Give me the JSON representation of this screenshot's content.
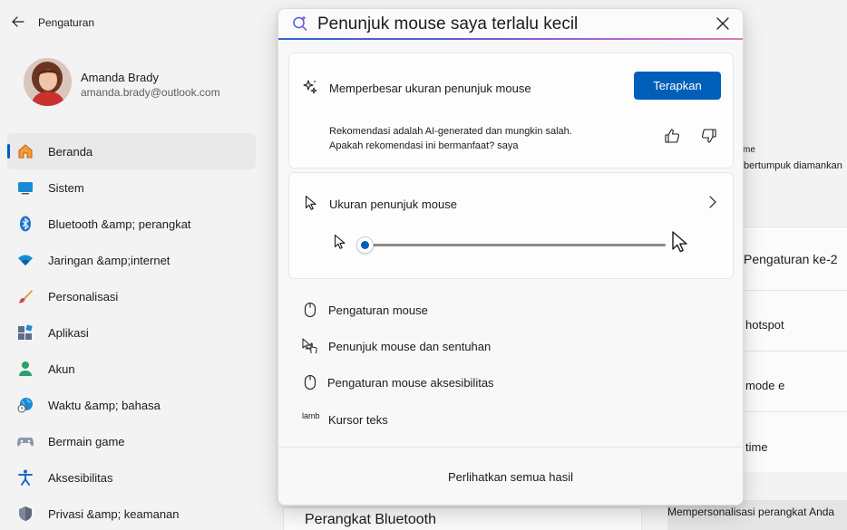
{
  "app": {
    "title": "Pengaturan"
  },
  "profile": {
    "name": "Amanda Brady",
    "email": "amanda.brady@outlook.com"
  },
  "nav": [
    {
      "label": "Beranda",
      "icon": "home-icon"
    },
    {
      "label": "Sistem",
      "icon": "system-icon"
    },
    {
      "label": "Bluetooth &amp; perangkat",
      "icon": "bluetooth-icon"
    },
    {
      "label": "Jaringan &amp;internet",
      "icon": "wifi-icon"
    },
    {
      "label": "Personalisasi",
      "icon": "brush-icon"
    },
    {
      "label": "Aplikasi",
      "icon": "apps-icon"
    },
    {
      "label": "Akun",
      "icon": "account-icon"
    },
    {
      "label": "Waktu &amp; bahasa",
      "icon": "globe-clock-icon"
    },
    {
      "label": "Bermain game",
      "icon": "gamepad-icon"
    },
    {
      "label": "Aksesibilitas",
      "icon": "accessibility-icon"
    },
    {
      "label": "Privasi &amp; keamanan",
      "icon": "shield-icon"
    }
  ],
  "background_right": {
    "frag_me": "me",
    "frag_saved": "bertumpuk diamankan",
    "rows": [
      "Pengaturan ke-2",
      "hotspot",
      "mode e",
      "time"
    ],
    "personalize": "Mempersonalisasi perangkat Anda",
    "bluetooth_heading": "Perangkat Bluetooth"
  },
  "search": {
    "query": "Penunjuk mouse saya terlalu kecil"
  },
  "recommendation": {
    "title": "Memperbesar ukuran penunjuk mouse",
    "apply_label": "Terapkan",
    "note": "Rekomendasi adalah AI-generated dan mungkin salah. Apakah rekomendasi ini bermanfaat? saya"
  },
  "pointer_size": {
    "title": "Ukuran penunjuk mouse",
    "slider_value": 0
  },
  "results": [
    {
      "label": "Pengaturan mouse",
      "icon": "mouse-icon"
    },
    {
      "label": "Penunjuk mouse dan sentuhan",
      "icon": "pointer-touch-icon"
    },
    {
      "label": "Pengaturan mouse aksesibilitas",
      "icon": "mouse-icon"
    },
    {
      "label": "Kursor teks",
      "glyph": "lamb"
    }
  ],
  "footer": {
    "see_all": "Perlihatkan semua hasil"
  },
  "colors": {
    "accent": "#005fb8"
  }
}
